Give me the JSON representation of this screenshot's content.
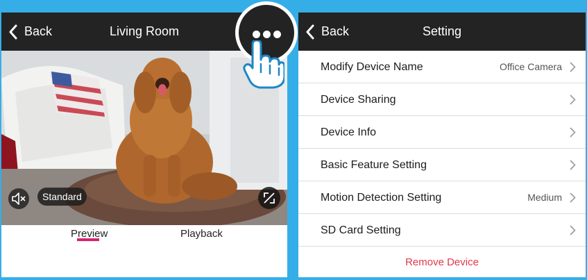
{
  "left_screen": {
    "back_label": "Back",
    "title": "Living Room",
    "quality_label": "Standard",
    "tabs": [
      {
        "label": "Preview",
        "active": true
      },
      {
        "label": "Playback",
        "active": false
      }
    ],
    "accent_color": "#d6246e"
  },
  "right_screen": {
    "back_label": "Back",
    "title": "Setting",
    "items": [
      {
        "label": "Modify Device Name",
        "value": "Office Camera"
      },
      {
        "label": "Device Sharing",
        "value": ""
      },
      {
        "label": "Device Info",
        "value": ""
      },
      {
        "label": "Basic Feature Setting",
        "value": ""
      },
      {
        "label": "Motion Detection Setting",
        "value": "Medium"
      },
      {
        "label": "SD Card Setting",
        "value": ""
      }
    ],
    "remove_label": "Remove Device",
    "remove_color": "#e0374d"
  },
  "icons": [
    "back-chevron-icon",
    "more-dots-icon",
    "pointing-hand-icon",
    "mute-speaker-icon",
    "fullscreen-icon",
    "chevron-right-icon"
  ],
  "colors": {
    "background": "#35aee8",
    "navbar": "#232323"
  }
}
